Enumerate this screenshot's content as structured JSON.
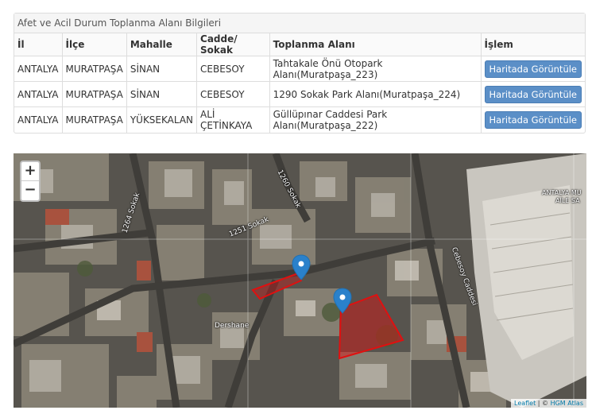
{
  "panel": {
    "title": "Afet ve Acil Durum Toplanma Alanı Bilgileri"
  },
  "table": {
    "headers": [
      "İl",
      "İlçe",
      "Mahalle",
      "Cadde/ Sokak",
      "Toplanma Alanı",
      "İşlem"
    ],
    "rows": [
      {
        "il": "ANTALYA",
        "ilce": "MURATPAŞA",
        "mahalle": "SİNAN",
        "cadde": "CEBESOY",
        "alan": "Tahtakale Önü Otopark Alanı(Muratpaşa_223)",
        "action": "Haritada Görüntüle"
      },
      {
        "il": "ANTALYA",
        "ilce": "MURATPAŞA",
        "mahalle": "SİNAN",
        "cadde": "CEBESOY",
        "alan": "1290 Sokak Park Alanı(Muratpaşa_224)",
        "action": "Haritada Görüntüle"
      },
      {
        "il": "ANTALYA",
        "ilce": "MURATPAŞA",
        "mahalle": "YÜKSEKALAN",
        "cadde": "ALİ ÇETİNKAYA",
        "alan": "Güllüpınar Caddesi Park Alanı(Muratpaşa_222)",
        "action": "Haritada Görüntüle"
      }
    ]
  },
  "map": {
    "zoom_in": "+",
    "zoom_out": "−",
    "attribution": {
      "leaflet": "Leaflet",
      "separator": " | © ",
      "provider": "HGM Atlas"
    },
    "labels": {
      "street_1264": "1264 Sokak",
      "street_1260": "1260 Sokak",
      "street_1251": "1251 Sokak",
      "street_cebesoy": "Cebesoy Caddesi",
      "place_dershane": "Dershane",
      "place_antalya": "ANTALYA MU",
      "place_aile": "AİLE SA"
    },
    "colors": {
      "polygon": "#e01010",
      "marker": "#2a81cb"
    }
  }
}
